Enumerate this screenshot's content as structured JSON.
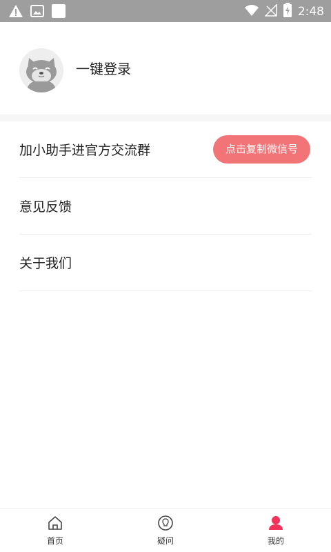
{
  "status_bar": {
    "time": "2:48",
    "icons": [
      "warning-icon",
      "image-icon",
      "square-icon",
      "wifi-icon",
      "no-signal-icon",
      "battery-charging-icon"
    ]
  },
  "header": {
    "login_label": "一键登录",
    "avatar_icon": "shiba-dog-avatar"
  },
  "menu": {
    "items": [
      {
        "label": "加小助手进官方交流群",
        "action_label": "点击复制微信号"
      },
      {
        "label": "意见反馈"
      },
      {
        "label": "关于我们"
      }
    ]
  },
  "bottom_nav": {
    "items": [
      {
        "label": "首页",
        "icon": "home-icon",
        "active": false
      },
      {
        "label": "疑问",
        "icon": "lightbulb-icon",
        "active": false
      },
      {
        "label": "我的",
        "icon": "user-icon",
        "active": true
      }
    ]
  },
  "colors": {
    "accent": "#f37477",
    "active_icon": "#f2325a",
    "status_bar": "#9e9e9e",
    "divider": "#f6f6f6"
  }
}
